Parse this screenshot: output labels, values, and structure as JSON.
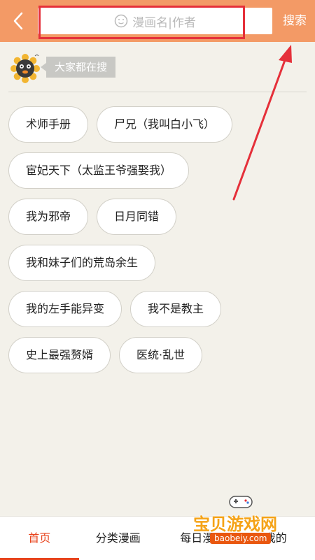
{
  "header": {
    "search_placeholder": "漫画名|作者",
    "search_button": "搜索"
  },
  "popular": {
    "label": "大家都在搜",
    "rows": [
      [
        "术师手册",
        "尸兄（我叫白小飞）"
      ],
      [
        "宦妃天下（太监王爷强娶我）"
      ],
      [
        "我为邪帝",
        "日月同错"
      ],
      [
        "我和妹子们的荒岛余生"
      ],
      [
        "我的左手能异变",
        "我不是教主"
      ],
      [
        "史上最强赘婿",
        "医统·乱世"
      ]
    ]
  },
  "bottom_nav": {
    "items": [
      "首页",
      "分类漫画",
      "每日漫",
      "我的"
    ],
    "active_index": 0
  },
  "watermark": {
    "title": "宝贝游戏网",
    "url": "baobeiy.com"
  },
  "colors": {
    "header_bg": "#f39a66",
    "accent": "#e8431c",
    "annotation_red": "#e5303a"
  }
}
